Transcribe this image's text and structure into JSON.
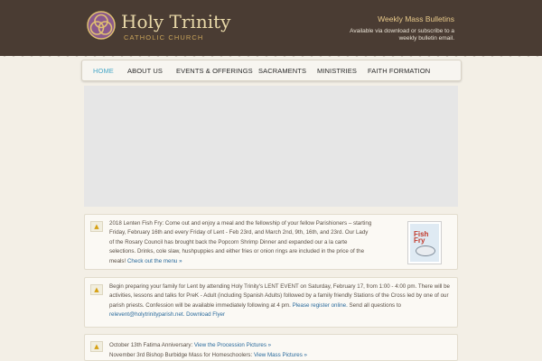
{
  "site": {
    "name": "Holy Trinity",
    "subtitle": "CATHOLIC CHURCH"
  },
  "bulletins": {
    "title": "Weekly Mass Bulletins",
    "text": "Available via download or subscribe to a weekly bulletin email."
  },
  "nav": {
    "items": [
      {
        "label": "HOME",
        "active": true
      },
      {
        "label": "ABOUT US",
        "active": false
      },
      {
        "label": "EVENTS & OFFERINGS",
        "active": false
      },
      {
        "label": "SACRAMENTS",
        "active": false
      },
      {
        "label": "MINISTRIES",
        "active": false
      },
      {
        "label": "FAITH FORMATION",
        "active": false
      }
    ]
  },
  "posts": [
    {
      "icon": "alert-icon",
      "text": "2018 Lenten Fish Fry: Come out and enjoy a meal and the fellowship of your fellow Parishioners – starting Friday, February 16th and every Friday of Lent - Feb 23rd, and March 2nd, 9th, 16th, and 23rd. Our Lady of the Rosary Council has brought back the Popcorn Shrimp Dinner and expanded our a la carte selections. Drinks, cole slaw, hushpuppies and either fries or onion rings are included in the price of the meals!",
      "link": "Check out the menu »",
      "thumb_label": "Fish Fry"
    },
    {
      "icon": "alert-icon",
      "text": "Begin preparing your family for Lent by attending Holy Trinity's LENT EVENT on Saturday, February 17, from 1:00 - 4:00 pm. There will be activities, lessons and talks for PreK - Adult (including Spanish Adults) followed by a family friendly Stations of the Cross led by one of our parish priests. Confession will be available immediately following at 4 pm.",
      "link1": "Please register online.",
      "text2": "Send all questions to",
      "link2": "relevent@holytrinityparish.net.",
      "link3": "Download Flyer"
    },
    {
      "icon": "alert-icon",
      "line1_text": "October 13th Fatima Anniversary:",
      "line1_link": "View the Procession Pictures »",
      "line2_text": "November 3rd Bishop Burbidge Mass for Homeschoolers:",
      "line2_link": "View Mass Pictures »"
    }
  ],
  "colors": {
    "header": "#4a3c33",
    "accent": "#4aa8c8",
    "link": "#2a6a9c",
    "gold": "#c8a35a"
  }
}
